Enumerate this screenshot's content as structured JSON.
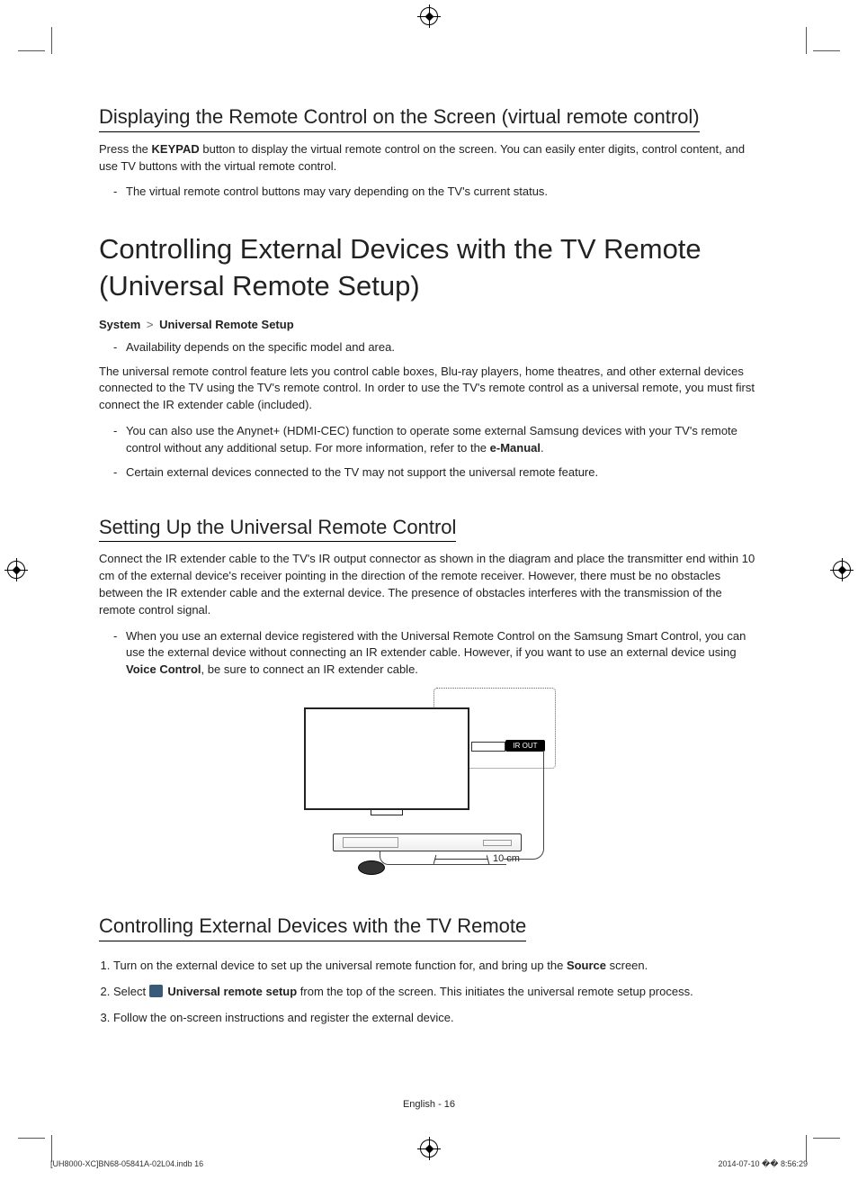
{
  "section1": {
    "title": "Displaying the Remote Control on the Screen (virtual remote control)",
    "p1_pre": "Press the ",
    "p1_bold": "KEYPAD",
    "p1_post": " button to display the virtual remote control on the screen. You can easily enter digits, control content, and use TV buttons with the virtual remote control.",
    "note1": "The virtual remote control buttons may vary depending on the TV's current status."
  },
  "section2": {
    "title": "Controlling External Devices with the TV Remote (Universal Remote Setup)",
    "breadcrumb_a": "System",
    "breadcrumb_b": "Universal Remote Setup",
    "note_avail": "Availability depends on the specific model and area.",
    "p1": "The universal remote control feature lets you control cable boxes, Blu-ray players, home theatres, and other external devices connected to the TV using the TV's remote control. In order to use the TV's remote control as a universal remote, you must first connect the IR extender cable (included).",
    "li1_pre": "You can also use the Anynet+ (HDMI-CEC) function to operate some external Samsung devices with your TV's remote control without any additional setup. For more information, refer to the ",
    "li1_bold": "e-Manual",
    "li1_post": ".",
    "li2": "Certain external devices connected to the TV may not support the universal remote feature."
  },
  "section3": {
    "title": "Setting Up the Universal Remote Control",
    "p1": "Connect the IR extender cable to the TV's IR output connector as shown in the diagram and place the transmitter end within 10 cm of the external device's receiver pointing in the direction of the remote receiver. However, there must be no obstacles between the IR extender cable and the external device. The presence of obstacles interferes with the transmission of the remote control signal.",
    "li1_pre": "When you use an external device registered with the Universal Remote Control on the Samsung Smart Control, you can use the external device without connecting an IR extender cable. However, if you want to use an external device using ",
    "li1_bold": "Voice Control",
    "li1_post": ", be sure to connect an IR extender cable."
  },
  "diagram": {
    "ir_out": "IR OUT",
    "distance": "10 cm"
  },
  "section4": {
    "title": "Controlling External Devices with the TV Remote",
    "step1_pre": "Turn on the external device to set up the universal remote function for, and bring up the ",
    "step1_bold": "Source",
    "step1_post": " screen.",
    "step2_pre": "Select ",
    "step2_bold": "Universal remote setup",
    "step2_post": " from the top of the screen. This initiates the universal remote setup process.",
    "step3": "Follow the on-screen instructions and register the external device."
  },
  "footer": {
    "page": "English - 16",
    "doc": "[UH8000-XC]BN68-05841A-02L04.indb   16",
    "date": "2014-07-10   �� 8:56:29"
  }
}
